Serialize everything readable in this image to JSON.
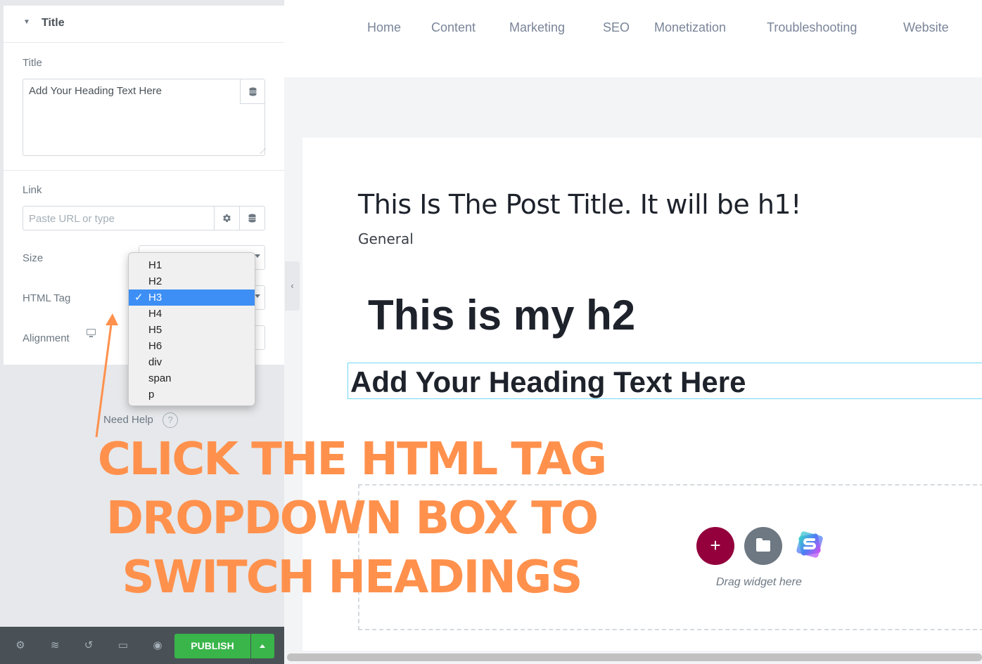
{
  "panel": {
    "section_title": "Title",
    "title_label": "Title",
    "title_value": "Add Your Heading Text Here",
    "link_label": "Link",
    "link_placeholder": "Paste URL or type",
    "size_label": "Size",
    "html_tag_label": "HTML Tag",
    "alignment_label": "Alignment",
    "need_help": "Need Help",
    "help_glyph": "?",
    "html_tag_options": [
      "H1",
      "H2",
      "H3",
      "H4",
      "H5",
      "H6",
      "div",
      "span",
      "p"
    ],
    "html_tag_selected": "H3",
    "check_glyph": "✓",
    "collapse_glyph": "‹"
  },
  "bottombar": {
    "publish_label": "PUBLISH",
    "icons": [
      "gear-icon",
      "layers-icon",
      "history-icon",
      "responsive-icon",
      "eye-icon"
    ]
  },
  "preview": {
    "nav": [
      "Home",
      "Content",
      "Marketing",
      "SEO",
      "Monetization",
      "Troubleshooting",
      "Website"
    ],
    "post_title": "This Is The Post Title. It will be h1!",
    "post_category": "General",
    "h2_text": "This is my h2",
    "h3_text": "Add Your Heading Text Here",
    "add_glyph": "+",
    "drag_text": "Drag widget here"
  },
  "annotation": {
    "lines": [
      "CLICK THE HTML TAG",
      "DROPDOWN BOX TO",
      "SWITCH HEADINGS"
    ],
    "color": "#ff914d"
  },
  "colors": {
    "publish_green": "#39b54a",
    "selected_blue": "#3d8ff5",
    "add_button": "#93003c",
    "folder_button": "#6d7882",
    "selection_outline": "#71d7f7"
  }
}
